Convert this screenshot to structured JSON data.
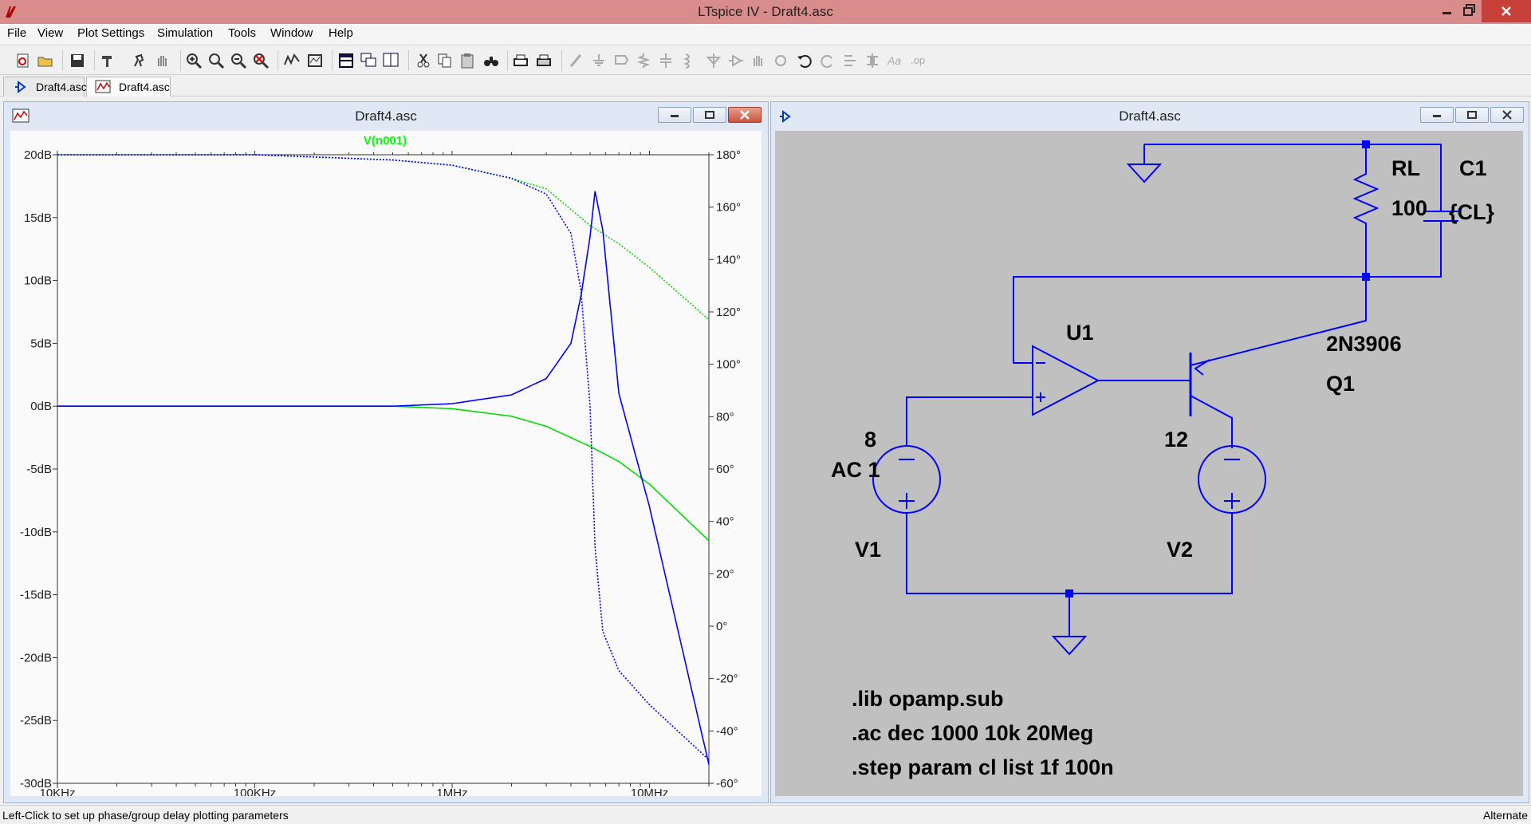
{
  "window": {
    "title": "LTspice IV - Draft4.asc"
  },
  "menu": [
    "File",
    "View",
    "Plot Settings",
    "Simulation",
    "Tools",
    "Window",
    "Help"
  ],
  "tabs": [
    {
      "label": "Draft4.asc",
      "type": "schematic"
    },
    {
      "label": "Draft4.asc",
      "type": "waveform",
      "active": true
    }
  ],
  "plot_window": {
    "title": "Draft4.asc",
    "trace_label": "V(n001)",
    "trace_color": "#00ff00",
    "left_axis_ticks": [
      "20dB",
      "15dB",
      "10dB",
      "5dB",
      "0dB",
      "-5dB",
      "-10dB",
      "-15dB",
      "-20dB",
      "-25dB",
      "-30dB"
    ],
    "right_axis_ticks": [
      "180°",
      "160°",
      "140°",
      "120°",
      "100°",
      "80°",
      "60°",
      "40°",
      "20°",
      "0°",
      "-20°",
      "-40°",
      "-60°"
    ],
    "x_axis_ticks": [
      "10KHz",
      "100KHz",
      "1MHz",
      "10MHz"
    ]
  },
  "chart_data": {
    "type": "line",
    "title": "V(n001)",
    "x_scale": "log",
    "xlim_hz": [
      10000,
      20000000
    ],
    "ylim_db": [
      -30,
      20
    ],
    "ylim_deg": [
      -60,
      180
    ],
    "grid": false,
    "series": [
      {
        "color": "#00dd00",
        "axis": "magnitude_db",
        "style": "solid",
        "x_hz": [
          10000,
          100000,
          500000,
          1000000,
          2000000,
          3000000,
          5000000,
          7000000,
          10000000,
          20000000
        ],
        "y": [
          0,
          0,
          0,
          -0.2,
          -0.8,
          -1.6,
          -3.2,
          -4.4,
          -6.2,
          -10.7
        ]
      },
      {
        "color": "#00dd00",
        "axis": "phase_deg",
        "style": "dotted",
        "x_hz": [
          10000,
          100000,
          500000,
          1000000,
          2000000,
          3000000,
          5000000,
          7000000,
          10000000,
          20000000
        ],
        "y": [
          180,
          180,
          178,
          176,
          171,
          167,
          153,
          146,
          137,
          117
        ]
      },
      {
        "color": "#0000ff",
        "axis": "magnitude_db",
        "style": "solid",
        "x_hz": [
          10000,
          100000,
          500000,
          1000000,
          2000000,
          3000000,
          4000000,
          4500000,
          5000000,
          5300000,
          5800000,
          7000000,
          10000000,
          20000000
        ],
        "y": [
          0,
          0,
          0,
          0.2,
          0.9,
          2.2,
          5.0,
          8.8,
          13.5,
          17.1,
          14.0,
          1.0,
          -8.0,
          -28.5
        ]
      },
      {
        "color": "#0000ff",
        "axis": "phase_deg",
        "style": "dotted",
        "x_hz": [
          10000,
          100000,
          500000,
          1000000,
          2000000,
          3000000,
          4000000,
          4500000,
          5000000,
          5300000,
          5800000,
          7000000,
          10000000,
          20000000
        ],
        "y": [
          180,
          180,
          178,
          176,
          171,
          165,
          150,
          128,
          84,
          30,
          -2,
          -17,
          -30,
          -51
        ]
      }
    ]
  },
  "schematic_window": {
    "title": "Draft4.asc",
    "labels": {
      "rl_name": "RL",
      "rl_value": "100",
      "c1_name": "C1",
      "c1_value": "{CL}",
      "u1_name": "U1",
      "q1_model": "2N3906",
      "q1_name": "Q1",
      "v1_value": "8",
      "v1_ac": "AC 1",
      "v1_name": "V1",
      "v2_value": "12",
      "v2_name": "V2",
      "plus": "+",
      "minus": "−"
    },
    "directives": [
      ".lib opamp.sub",
      ".ac dec 1000 10k 20Meg",
      ".step param cl list 1f 100n"
    ]
  },
  "status": {
    "left": "Left-Click to set up phase/group delay plotting parameters",
    "right": "Alternate"
  },
  "colors": {
    "wire": "#0000ff",
    "schematic_bg": "#c0c0c0",
    "plot_bg": "#fafafa",
    "title_bg": "#d88c8c"
  }
}
